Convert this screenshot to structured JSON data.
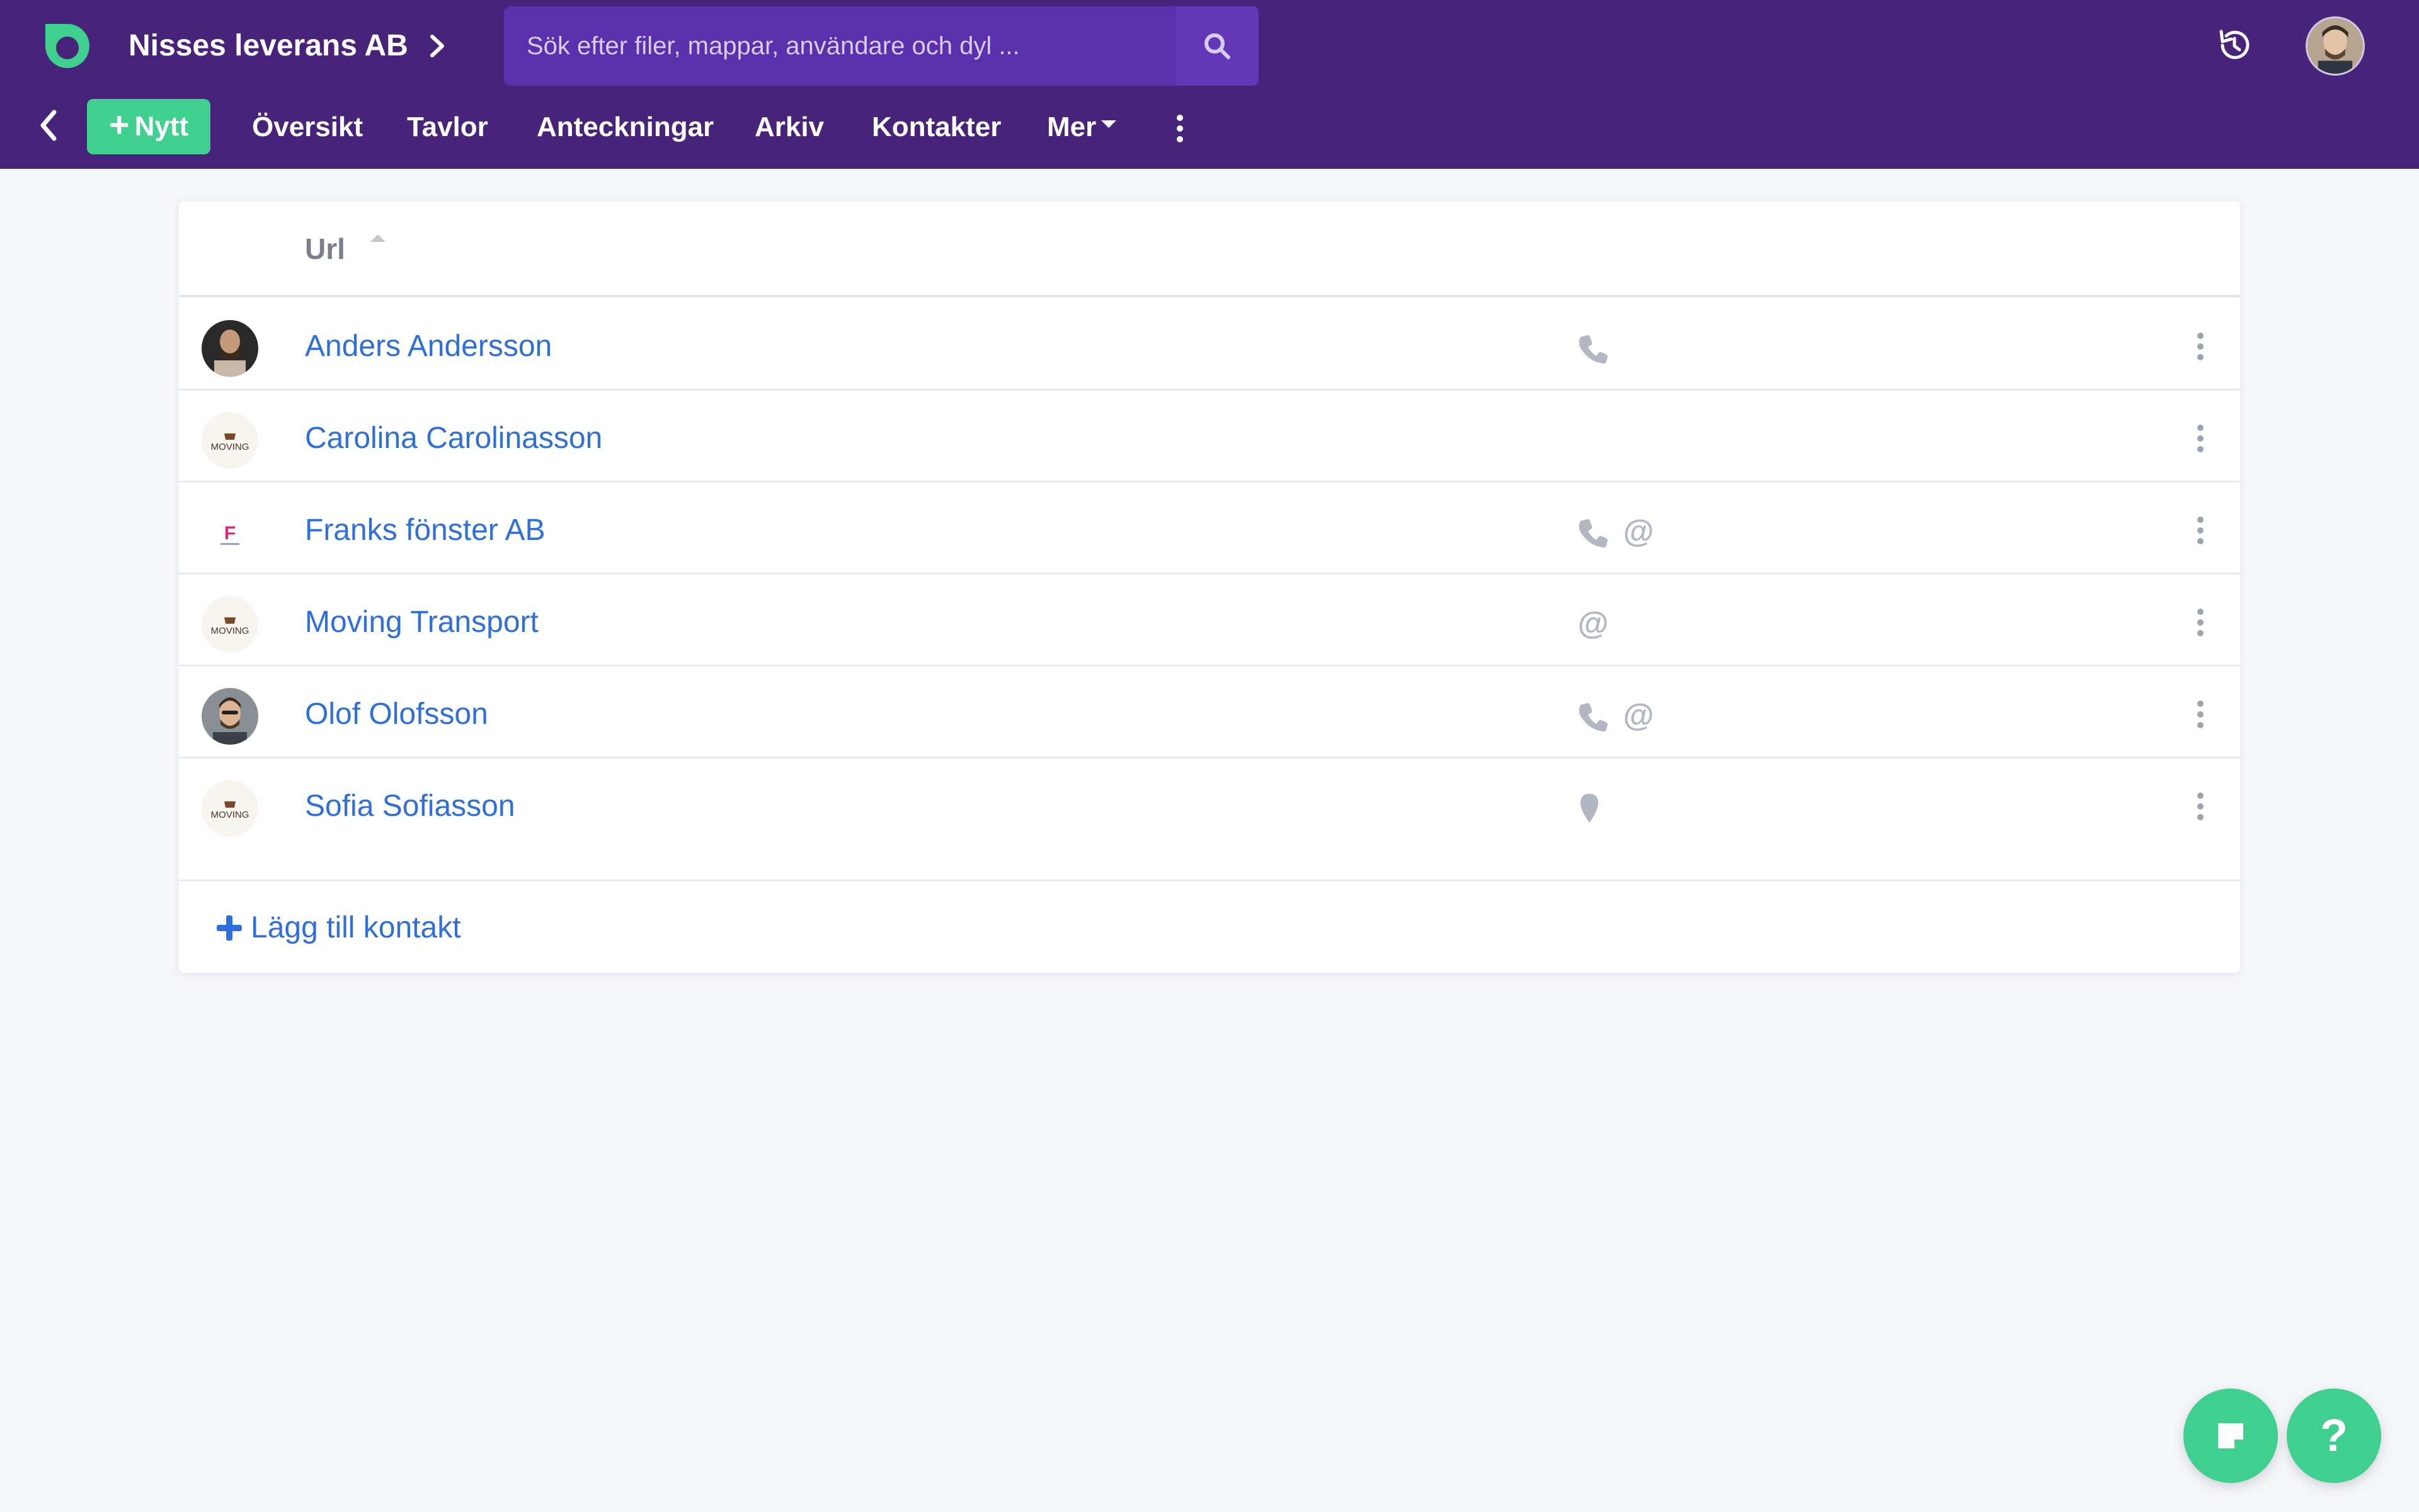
{
  "header": {
    "org_name": "Nisses leverans AB",
    "search_placeholder": "Sök efter filer, mappar, användare och dyl ...",
    "accent_color": "#47237a",
    "brand_green": "#3fcf8e"
  },
  "nav": {
    "new_label": "Nytt",
    "items": [
      "Översikt",
      "Tavlor",
      "Anteckningar",
      "Arkiv",
      "Kontakter"
    ],
    "more_label": "Mer"
  },
  "table": {
    "column_header": "Url",
    "sort_direction": "ascending",
    "rows": [
      {
        "name": "Anders Andersson",
        "avatar": "photo-person",
        "icons": [
          "phone-icon"
        ]
      },
      {
        "name": "Carolina Carolinasson",
        "avatar": "moving-logo",
        "icons": []
      },
      {
        "name": "Franks fönster AB",
        "avatar": "franks-logo",
        "icons": [
          "phone-icon",
          "at-icon"
        ]
      },
      {
        "name": "Moving Transport",
        "avatar": "moving-logo",
        "icons": [
          "at-icon"
        ]
      },
      {
        "name": "Olof Olofsson",
        "avatar": "photo-person",
        "icons": [
          "phone-icon",
          "at-icon"
        ]
      },
      {
        "name": "Sofia Sofiasson",
        "avatar": "moving-logo",
        "icons": [
          "map-pin-icon"
        ]
      }
    ],
    "add_label": "Lägg till kontakt",
    "avatar_labels": {
      "moving": "MOVING",
      "franks": "F"
    }
  },
  "fabs": {
    "help_label": "?"
  }
}
